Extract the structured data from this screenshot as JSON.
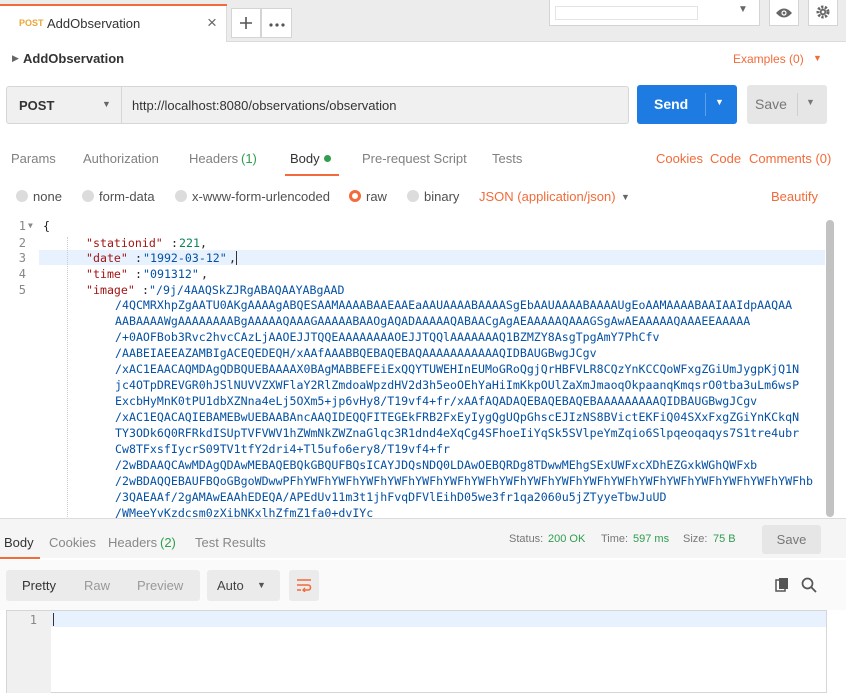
{
  "tab": {
    "method": "POST",
    "name": "AddObservation"
  },
  "request": {
    "title": "AddObservation",
    "examples_label": "Examples (0)",
    "method": "POST",
    "url": "http://localhost:8080/observations/observation",
    "send_label": "Send",
    "save_label": "Save"
  },
  "request_tabs": {
    "params": "Params",
    "authorization": "Authorization",
    "headers": "Headers",
    "headers_count": "(1)",
    "body": "Body",
    "prerequest": "Pre-request Script",
    "tests": "Tests",
    "cookies": "Cookies",
    "code": "Code",
    "comments": "Comments (0)"
  },
  "body_options": {
    "none": "none",
    "form_data": "form-data",
    "urlencoded": "x-www-form-urlencoded",
    "raw": "raw",
    "binary": "binary",
    "content_type": "JSON (application/json)",
    "beautify": "Beautify"
  },
  "editor": {
    "line_numbers": [
      "1",
      "2",
      "3",
      "4",
      "5"
    ],
    "open_brace": "{",
    "key_stationid": "\"stationid\"",
    "val_stationid": "221",
    "key_date": "\"date\"",
    "val_date": "\"1992-03-12\"",
    "key_time": "\"time\"",
    "val_time": "\"091312\"",
    "key_image": "\"image\"",
    "image_lines": [
      "\"/9j/4AAQSkZJRgABAQAAYABgAAD",
      "/4QCMRXhpZgAATU0AKgAAAAgABQESAAMAAAABAAEAAEaAAUAAAABAAAASgEbAAUAAAABAAAAUgEoAAMAAAABAAIAAIdpAAQAA",
      "AABAAAAWgAAAAAAAABgAAAAAQAAAGAAAAABAAOgAQADAAAAAQABAACgAgAEAAAAAQAAAGSgAwAEAAAAAQAAAEEAAAAA",
      "/+0AOFBob3Rvc2hvcCAzLjAAOEJJTQQEAAAAAAAAOEJJTQQlAAAAAAAQ1BZMZY8AsgTpgAmY7PhCfv",
      "/AABEIAEEAZAMBIgACEQEDEQH/xAAfAAABBQEBAQEBAQAAAAAAAAAAAQIDBAUGBwgJCgv",
      "/xAC1EAACAQMDAgQDBQUEBAAAAX0BAgMABBEFEiExQQYTUWEHInEUMoGRoQgjQrHBFVLR8CQzYnKCCQoWFxgZGiUmJygpKjQ1N",
      "jc4OTpDREVGR0hJSlNUVVZXWFlaY2RlZmdoaWpzdHV2d3h5eoOEhYaHiImKkpOUlZaXmJmaoqOkpaanqKmqsrO0tba3uLm6wsP",
      "ExcbHyMnK0tPU1dbXZNna4eLj5OXm5+jp6vHy8/T19vf4+fr/xAAfAQADAQEBAQEBAQEBAAAAAAAAAQIDBAUGBwgJCgv",
      "/xAC1EQACAQIEBAMEBwUEBAABAncAAQIDEQQFITEGEkFRB2FxEyIygQgUQpGhscEJIzNS8BVictEKFiQ04SXxFxgZGiYnKCkqN",
      "TY3ODk6Q0RFRkdISUpTVFVWV1hZWmNkZWZnaGlqc3R1dnd4eXqCg4SFhoeIiYqSk5SVlpeYmZqio6Slpqeoqaqys7S1tre4ubr",
      "Cw8TFxsfIycrS09TV1tfY2dri4+Tl5ufo6ery8/T19vf4+fr",
      "/2wBDAAQCAwMDAgQDAwMEBAQEBQkGBQUFBQsICAYJDQsNDQ0LDAwOEBQRDg8TDwwMEhgSExUWFxcXDhEZGxkWGhQWFxb",
      "/2wBDAQQEBAUFBQoGBgoWDwwPFhYWFhYWFhYWFhYWFhYWFhYWFhYWFhYWFhYWFhYWFhYWFhYWFhYWFhYWFhYWFhYWFhYWFhYWFhb",
      "/3QAEAAf/2gAMAwEAAhEDEQA/APEdUv11m3t1jhFvqDFVlEihD05we3fr1qa2060u5jZTyyeTbwJuUD",
      "/WMeeYvKzdcsm0zXibNKxlhZfmZ1fa0+dvIYc"
    ],
    "colors": {
      "key": "#a31515",
      "string": "#0451a5",
      "number": "#098658"
    }
  },
  "response": {
    "tabs": {
      "body": "Body",
      "cookies": "Cookies",
      "headers": "Headers",
      "headers_count": "(2)",
      "test_results": "Test Results"
    },
    "status_label": "Status:",
    "status_value": "200 OK",
    "time_label": "Time:",
    "time_value": "597 ms",
    "size_label": "Size:",
    "size_value": "75 B",
    "save_label": "Save",
    "views": {
      "pretty": "Pretty",
      "raw": "Raw",
      "preview": "Preview"
    },
    "format": "Auto",
    "line_number": "1"
  },
  "colors": {
    "accent": "#f26b3a",
    "send": "#1e7be2",
    "success": "#2e9e4f"
  },
  "icons": [
    "close-icon",
    "plus-icon",
    "more-icon",
    "eye-icon",
    "gear-icon",
    "caret-right-icon",
    "wrap-icon",
    "copy-icon",
    "search-icon"
  ]
}
